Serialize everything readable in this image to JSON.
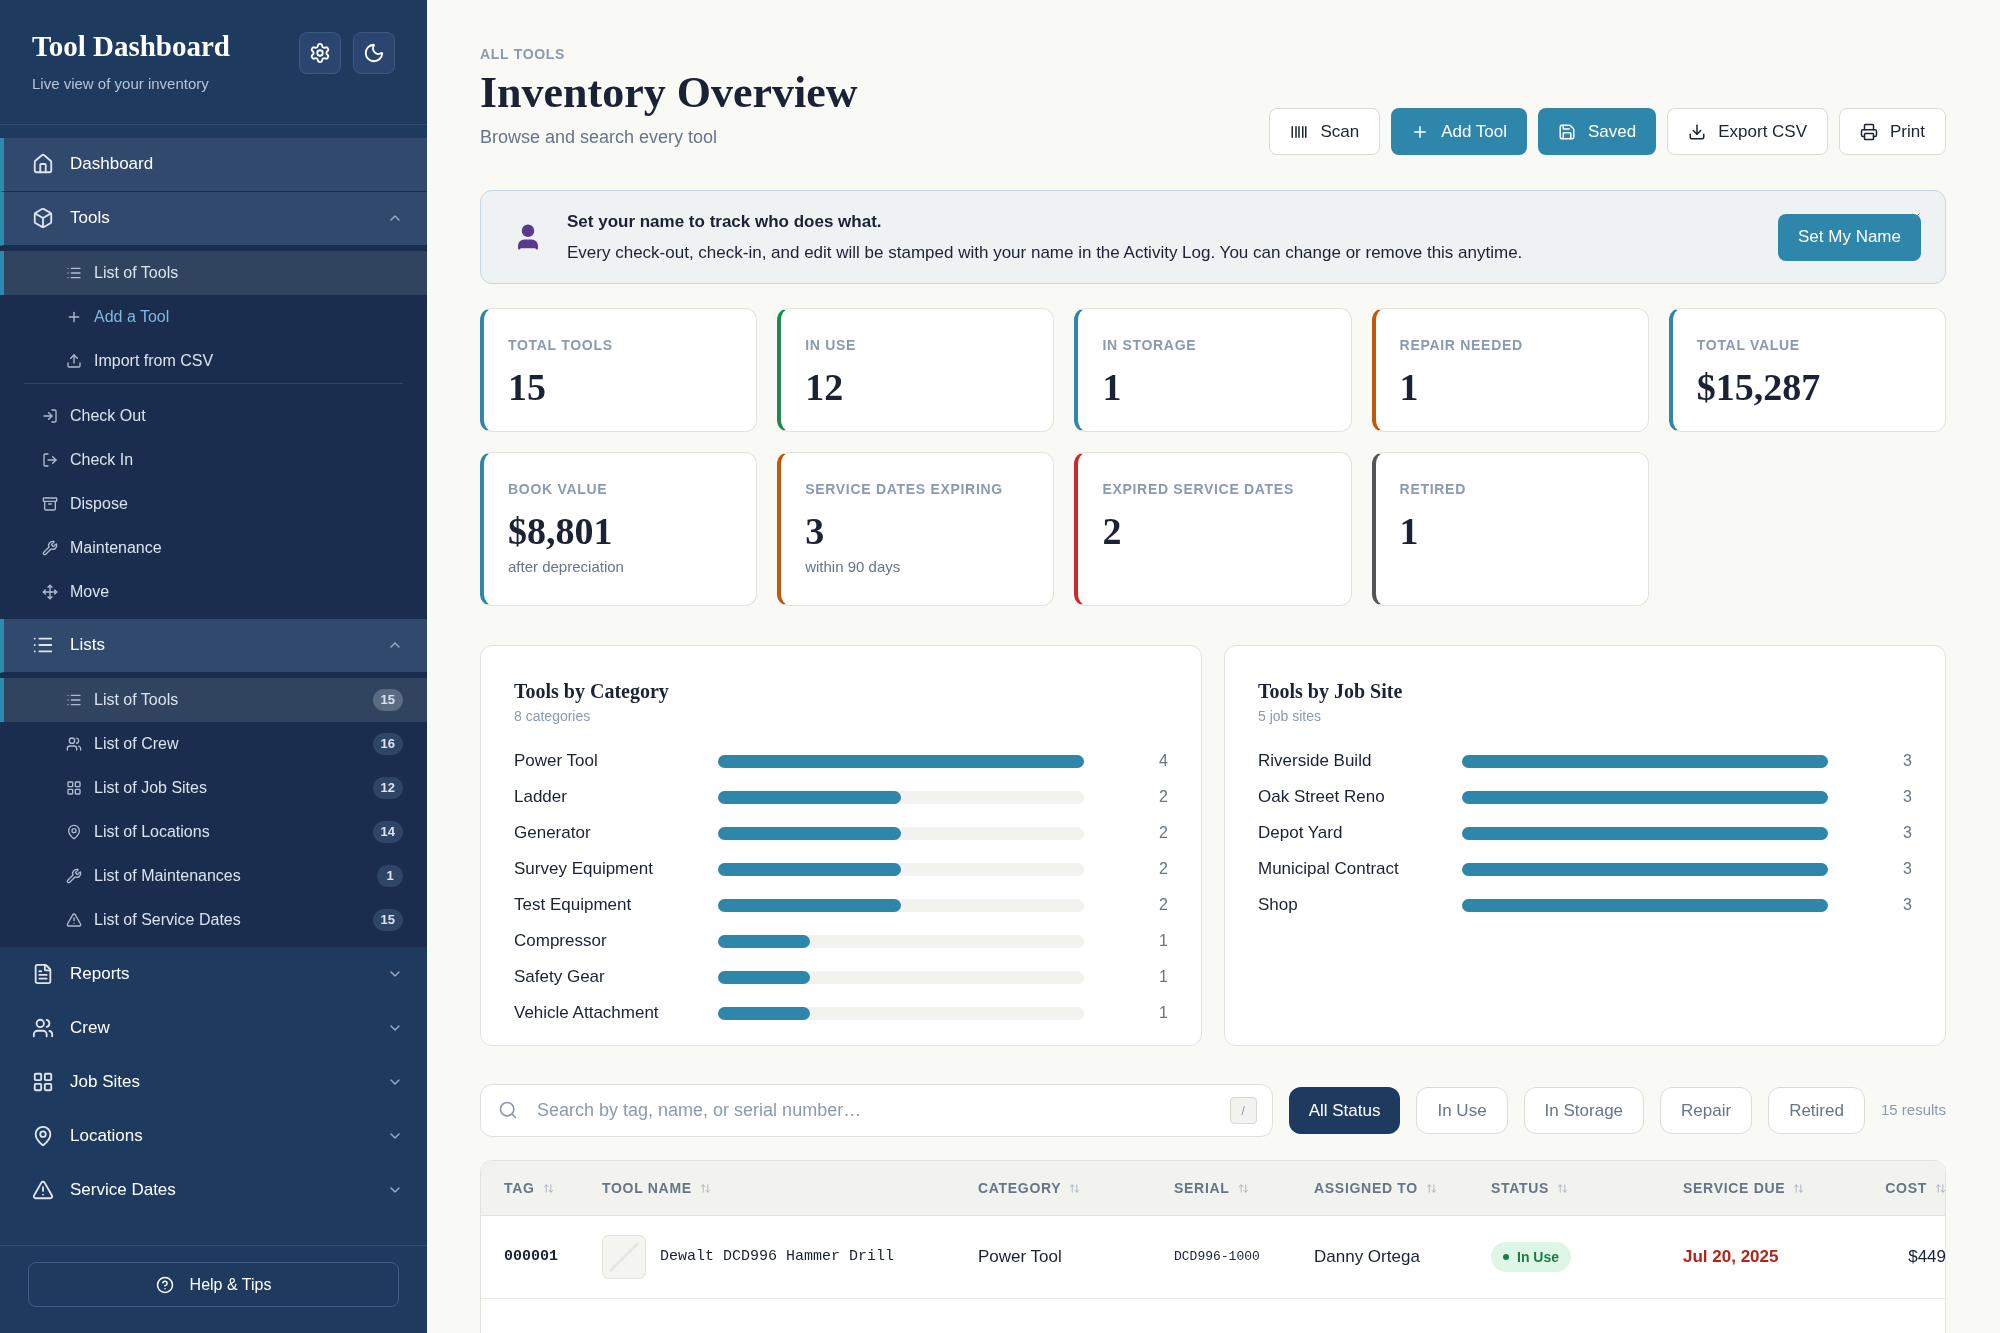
{
  "sidebar": {
    "title": "Tool Dashboard",
    "subtitle": "Live view of your inventory",
    "sections": [
      {
        "label": "Dashboard",
        "selected": true
      },
      {
        "label": "Tools",
        "selected": true,
        "expanded": true,
        "groups": [
          [
            {
              "label": "List of Tools",
              "selected": true,
              "highlight": false
            },
            {
              "label": "Add a Tool",
              "selected": false,
              "highlight": true
            },
            {
              "label": "Import from CSV",
              "selected": false,
              "highlight": false
            }
          ],
          [
            {
              "label": "Check Out",
              "selected": false,
              "highlight": false
            },
            {
              "label": "Check In",
              "selected": false,
              "highlight": false
            },
            {
              "label": "Dispose",
              "selected": false,
              "highlight": false
            },
            {
              "label": "Maintenance",
              "selected": false,
              "highlight": false
            },
            {
              "label": "Move",
              "selected": false,
              "highlight": false
            }
          ]
        ]
      },
      {
        "label": "Lists",
        "selected": true,
        "expanded": true,
        "groups": [
          [
            {
              "label": "List of Tools",
              "selected": true,
              "highlight": false,
              "count": "15"
            },
            {
              "label": "List of Crew",
              "selected": false,
              "highlight": false,
              "count": "16"
            },
            {
              "label": "List of Job Sites",
              "selected": false,
              "highlight": false,
              "count": "12"
            },
            {
              "label": "List of Locations",
              "selected": false,
              "highlight": false,
              "count": "14"
            },
            {
              "label": "List of Maintenances",
              "selected": false,
              "highlight": false,
              "count": "1"
            },
            {
              "label": "List of Service Dates",
              "selected": false,
              "highlight": false,
              "count": "15"
            }
          ]
        ]
      },
      {
        "label": "Reports",
        "selected": false,
        "expanded": false
      },
      {
        "label": "Crew",
        "selected": false,
        "expanded": false
      },
      {
        "label": "Job Sites",
        "selected": false,
        "expanded": false
      },
      {
        "label": "Locations",
        "selected": false,
        "expanded": false
      },
      {
        "label": "Service Dates",
        "selected": false,
        "expanded": false
      }
    ],
    "help_button": "Help & Tips"
  },
  "header": {
    "eyebrow": "ALL TOOLS",
    "title": "Inventory Overview",
    "subtitle": "Browse and search every tool",
    "buttons": [
      {
        "label": "Scan",
        "primary": false
      },
      {
        "label": "Add Tool",
        "primary": true
      },
      {
        "label": "Saved",
        "primary": true
      },
      {
        "label": "Export CSV",
        "primary": false
      },
      {
        "label": "Print",
        "primary": false
      }
    ]
  },
  "banner": {
    "title": "Set your name to track who does what.",
    "text": "Every check-out, check-in, and edit will be stamped with your name in the Activity Log. You can change or remove this anytime.",
    "button": "Set My Name"
  },
  "stats": [
    {
      "label": "TOTAL TOOLS",
      "value": "15",
      "color": "#2e86ab"
    },
    {
      "label": "IN USE",
      "value": "12",
      "color": "#1f8a4c"
    },
    {
      "label": "IN STORAGE",
      "value": "1",
      "color": "#2e86ab"
    },
    {
      "label": "REPAIR NEEDED",
      "value": "1",
      "color": "#c2570c"
    },
    {
      "label": "TOTAL VALUE",
      "value": "$15,287",
      "color": "#2e86ab"
    },
    {
      "label": "BOOK VALUE",
      "value": "$8,801",
      "note": "after depreciation",
      "color": "#2e86ab"
    },
    {
      "label": "SERVICE DATES EXPIRING",
      "value": "3",
      "note": "within 90 days",
      "color": "#c2570c"
    },
    {
      "label": "EXPIRED SERVICE DATES",
      "value": "2",
      "color": "#c92a2a"
    },
    {
      "label": "RETIRED",
      "value": "1",
      "color": "#555555"
    }
  ],
  "charts": [
    {
      "title": "Tools by Category",
      "subtitle": "8 categories",
      "rows": [
        {
          "label": "Power Tool",
          "count": "4",
          "level": 1
        },
        {
          "label": "Ladder",
          "count": "2",
          "level": 0.5
        },
        {
          "label": "Generator",
          "count": "2",
          "level": 0.5
        },
        {
          "label": "Survey Equipment",
          "count": "2",
          "level": 0.5
        },
        {
          "label": "Test Equipment",
          "count": "2",
          "level": 0.5
        },
        {
          "label": "Compressor",
          "count": "1",
          "level": 0.25
        },
        {
          "label": "Safety Gear",
          "count": "1",
          "level": 0.25
        },
        {
          "label": "Vehicle Attachment",
          "count": "1",
          "level": 0.25
        }
      ]
    },
    {
      "title": "Tools by Job Site",
      "subtitle": "5 job sites",
      "rows": [
        {
          "label": "Riverside Build",
          "count": "3",
          "level": 1
        },
        {
          "label": "Oak Street Reno",
          "count": "3",
          "level": 1
        },
        {
          "label": "Depot Yard",
          "count": "3",
          "level": 1
        },
        {
          "label": "Municipal Contract",
          "count": "3",
          "level": 1
        },
        {
          "label": "Shop",
          "count": "3",
          "level": 1
        }
      ]
    }
  ],
  "search": {
    "placeholder": "Search by tag, name, or serial number…",
    "shortcut": "/"
  },
  "filters": [
    {
      "label": "All Status",
      "selected": true
    },
    {
      "label": "In Use",
      "selected": false
    },
    {
      "label": "In Storage",
      "selected": false
    },
    {
      "label": "Repair",
      "selected": false
    },
    {
      "label": "Retired",
      "selected": false
    }
  ],
  "results": "15 results",
  "table": {
    "columns": [
      "TAG",
      "TOOL NAME",
      "CATEGORY",
      "SERIAL",
      "ASSIGNED TO",
      "STATUS",
      "SERVICE DUE",
      "COST"
    ],
    "rows": [
      {
        "tag": "000001",
        "name": "Dewalt DCD996 Hammer Drill",
        "category": "Power Tool",
        "serial": "DCD996-1000",
        "assigned": "Danny Ortega",
        "status": "In Use",
        "service_due": "Jul 20, 2025",
        "overdue": true,
        "cost": "$449"
      }
    ]
  }
}
